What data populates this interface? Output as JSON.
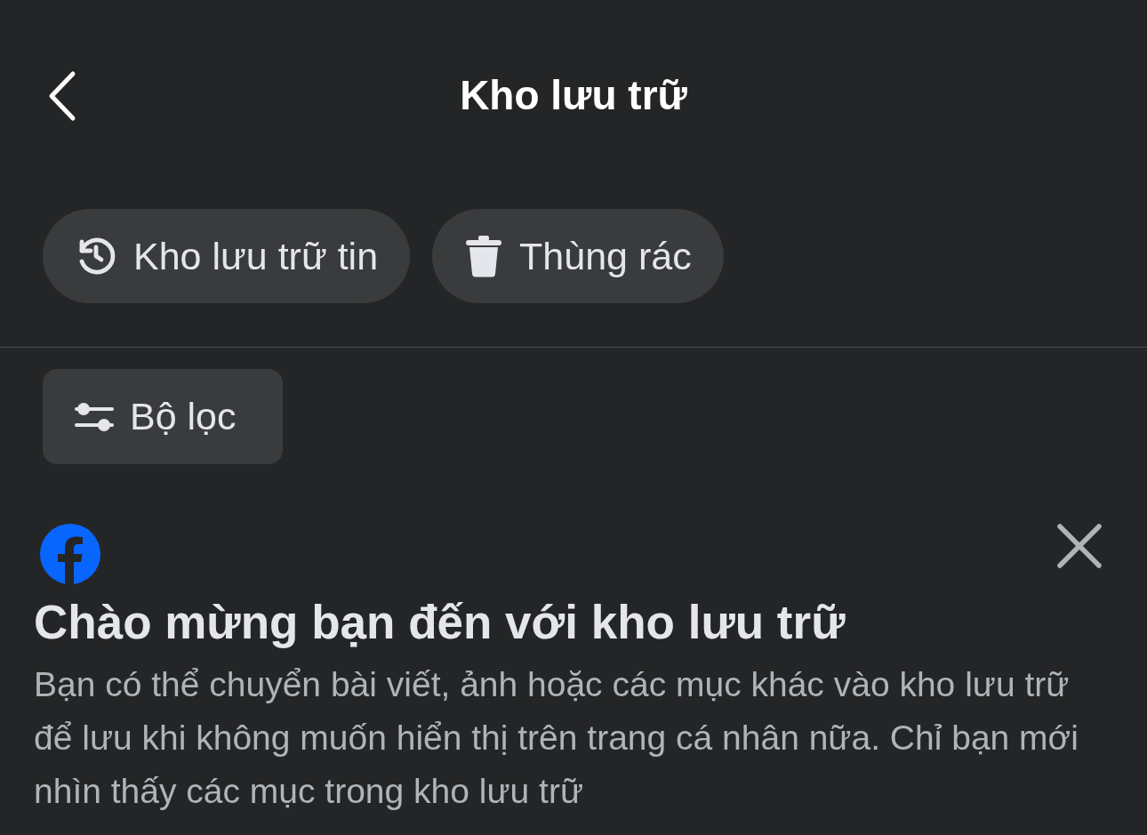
{
  "header": {
    "title": "Kho lưu trữ"
  },
  "chips": [
    {
      "label": "Kho lưu trữ tin",
      "kind": "history"
    },
    {
      "label": "Thùng rác",
      "kind": "trash"
    }
  ],
  "filter": {
    "label": "Bộ lọc"
  },
  "card": {
    "title": "Chào mừng bạn đến với kho lưu trữ",
    "text": "Bạn có thể chuyển bài viết, ảnh hoặc các mục khác vào kho lưu trữ để lưu khi không muốn hiển thị trên trang cá nhân nữa. Chỉ bạn mới nhìn thấy các mục trong kho lưu trữ"
  }
}
